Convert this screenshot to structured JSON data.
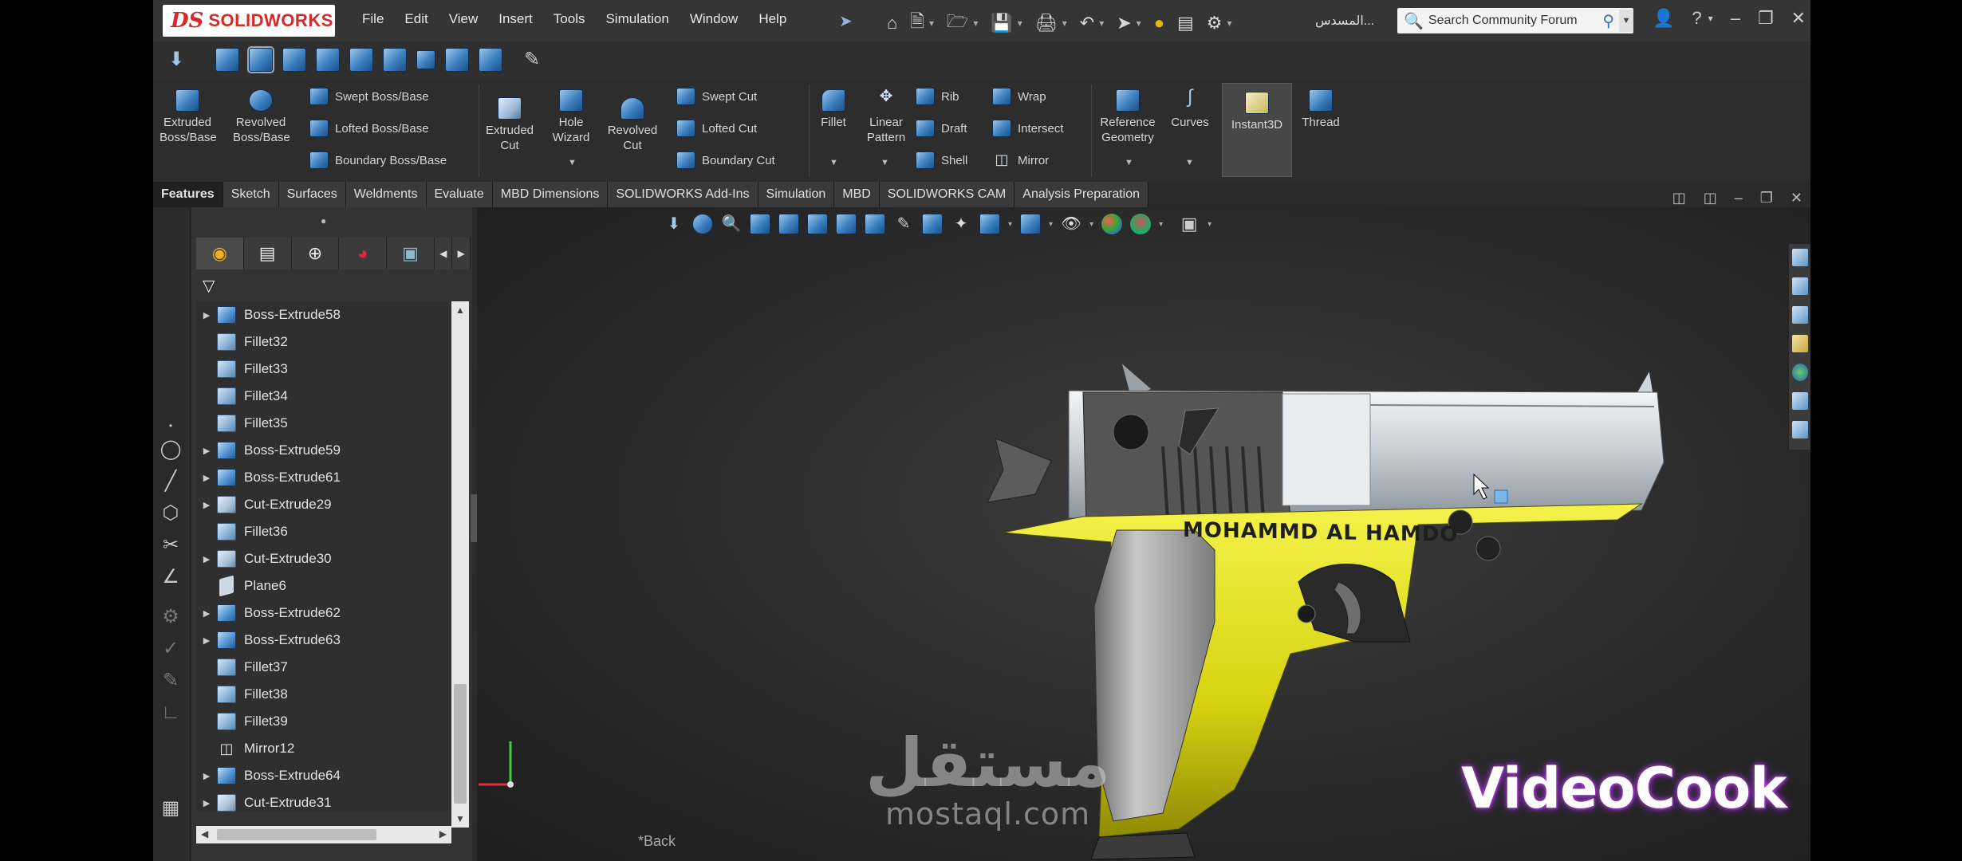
{
  "app": {
    "brand": "SOLIDWORKS",
    "brand_ds": "DS"
  },
  "menu": [
    "File",
    "Edit",
    "View",
    "Insert",
    "Tools",
    "Simulation",
    "Window",
    "Help"
  ],
  "user_name": "...المسدس",
  "search": {
    "placeholder": "Search Community Forum"
  },
  "command_manager": {
    "extruded_boss": "Extruded Boss/Base",
    "revolved_boss": "Revolved Boss/Base",
    "swept_boss": "Swept Boss/Base",
    "lofted_boss": "Lofted Boss/Base",
    "boundary_boss": "Boundary Boss/Base",
    "extruded_cut": "Extruded Cut",
    "hole_wizard": "Hole Wizard",
    "revolved_cut": "Revolved Cut",
    "swept_cut": "Swept Cut",
    "lofted_cut": "Lofted Cut",
    "boundary_cut": "Boundary Cut",
    "fillet": "Fillet",
    "linear_pattern": "Linear Pattern",
    "rib": "Rib",
    "draft": "Draft",
    "shell": "Shell",
    "wrap": "Wrap",
    "intersect": "Intersect",
    "mirror": "Mirror",
    "reference_geometry": "Reference Geometry",
    "curves": "Curves",
    "instant3d": "Instant3D",
    "thread": "Thread"
  },
  "tabs": [
    {
      "label": "Features",
      "active": true
    },
    {
      "label": "Sketch"
    },
    {
      "label": "Surfaces"
    },
    {
      "label": "Weldments"
    },
    {
      "label": "Evaluate"
    },
    {
      "label": "MBD Dimensions"
    },
    {
      "label": "SOLIDWORKS Add-Ins"
    },
    {
      "label": "Simulation"
    },
    {
      "label": "MBD"
    },
    {
      "label": "SOLIDWORKS CAM"
    },
    {
      "label": "Analysis Preparation"
    }
  ],
  "feature_tree": [
    {
      "label": "Boss-Extrude58",
      "type": "boss",
      "expandable": true
    },
    {
      "label": "Fillet32",
      "type": "fillet"
    },
    {
      "label": "Fillet33",
      "type": "fillet"
    },
    {
      "label": "Fillet34",
      "type": "fillet"
    },
    {
      "label": "Fillet35",
      "type": "fillet"
    },
    {
      "label": "Boss-Extrude59",
      "type": "boss",
      "expandable": true
    },
    {
      "label": "Boss-Extrude61",
      "type": "boss",
      "expandable": true
    },
    {
      "label": "Cut-Extrude29",
      "type": "cut",
      "expandable": true
    },
    {
      "label": "Fillet36",
      "type": "fillet"
    },
    {
      "label": "Cut-Extrude30",
      "type": "cut",
      "expandable": true
    },
    {
      "label": "Plane6",
      "type": "plane"
    },
    {
      "label": "Boss-Extrude62",
      "type": "boss",
      "expandable": true
    },
    {
      "label": "Boss-Extrude63",
      "type": "boss",
      "expandable": true
    },
    {
      "label": "Fillet37",
      "type": "fillet"
    },
    {
      "label": "Fillet38",
      "type": "fillet"
    },
    {
      "label": "Fillet39",
      "type": "fillet"
    },
    {
      "label": "Mirror12",
      "type": "mirror"
    },
    {
      "label": "Boss-Extrude64",
      "type": "boss",
      "expandable": true
    },
    {
      "label": "Cut-Extrude31",
      "type": "cut",
      "expandable": true
    }
  ],
  "viewport": {
    "engraving": "MOHAMMD AL HAMDO",
    "back_label": "*Back"
  },
  "watermarks": {
    "mostaql_ar": "مستقل",
    "mostaql_en": "mostaql.com",
    "videocook": "VideoCook"
  },
  "colors": {
    "gun_yellow": "#e4e21c",
    "slide_silver": "#d8dde2",
    "accent_blue": "#3c7fc0"
  }
}
